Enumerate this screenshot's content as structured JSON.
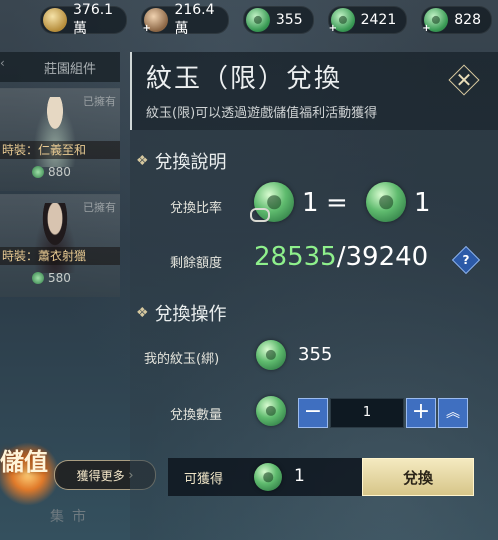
{
  "resources": [
    {
      "icon": "gold-ingot-icon",
      "value": "376.1萬"
    },
    {
      "icon": "bronze-coin-icon",
      "value": "216.4萬"
    },
    {
      "icon": "jade-coin-icon",
      "value": "355"
    },
    {
      "icon": "jade-coin-icon",
      "value": "2421"
    },
    {
      "icon": "jade-coin-icon",
      "value": "828"
    }
  ],
  "sidebar": {
    "tab_label": "莊園組件",
    "items": [
      {
        "owned": "已擁有",
        "caption": "時裝：仁義至和",
        "price": "880"
      },
      {
        "owned": "已擁有",
        "caption": "時裝：蕭衣射獵",
        "price": "580"
      }
    ],
    "vip_label": "儲值",
    "get_more": "獲得更多",
    "market": "集市"
  },
  "panel": {
    "title": "紋玉（限）兌換",
    "subtitle": "紋玉(限)可以透過遊戲儲值福利活動獲得",
    "section_info": "兌換說明",
    "ratio_label": "兌換比率",
    "ratio_left": "1",
    "ratio_eq": "=",
    "ratio_right": "1",
    "quota_label": "剩餘額度",
    "quota_used": "28535",
    "quota_sep": "/",
    "quota_total": "39240",
    "help": "?",
    "section_op": "兌換操作",
    "my_jade_label": "我的紋玉(綁)",
    "my_jade_value": "355",
    "qty_label": "兌換數量",
    "qty_minus": "−",
    "qty_value": "1",
    "qty_plus": "+",
    "qty_max": "︽",
    "obtain_label": "可獲得",
    "obtain_value": "1",
    "exchange_button": "兌換"
  },
  "colors": {
    "accent_green": "#8ff08c",
    "button_blue": "#3f6fc0",
    "button_gold": "#e8dca4"
  }
}
